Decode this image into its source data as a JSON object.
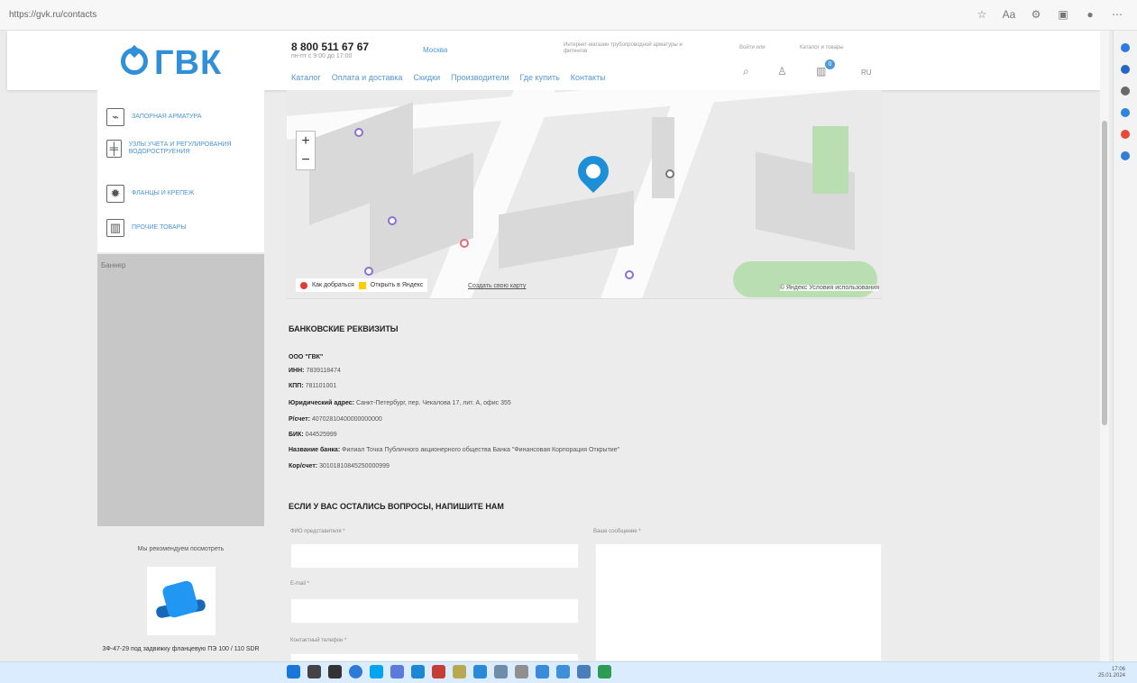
{
  "browser": {
    "address": "https://gvk.ru/contacts"
  },
  "header": {
    "logo": "ГВК",
    "phone": "8 800 511 67 67",
    "hours": "пн-пт с 9:00 до 17:00",
    "city": "Москва",
    "note": "Интернет-магазин трубопроводной арматуры и фитингов",
    "menu": [
      "Каталог",
      "Оплата и доставка",
      "Скидки",
      "Производители",
      "Где купить",
      "Контакты"
    ],
    "labels": {
      "left": "Войти или",
      "right": "Каталог и товары"
    },
    "cart_count": "0",
    "extra": "RU"
  },
  "sidebar": {
    "items": [
      {
        "label": "ЗАПОРНАЯ АРМАТУРА",
        "icon": "valve-icon"
      },
      {
        "label": "УЗЛЫ УЧЕТА И РЕГУЛИРОВАНИЯ ВОДОРОСТРУЕНИЯ",
        "icon": "pipe-icon"
      },
      {
        "label": "ФЛАНЦЫ И КРЕПЕЖ",
        "icon": "gear-icon"
      },
      {
        "label": "ПРОЧИЕ ТОВАРЫ",
        "icon": "box-icon"
      }
    ],
    "banner": "Баннер",
    "popular_title": "Мы рекомендуем посмотреть",
    "product": "ЗФ-47-29 под задвижку фланцевую ПЭ 100 / 110 SDR"
  },
  "map": {
    "zoom_in": "+",
    "zoom_out": "−",
    "route": "Как добраться",
    "open": "Открыть в Яндекс",
    "create": "Создать свою карту",
    "copyright": "© Яндекс Условия использования"
  },
  "bank": {
    "title": "Банковские реквизиты",
    "lines": [
      {
        "label": "ООО \"ГВК\"",
        "value": ""
      },
      {
        "label": "ИНН:",
        "value": "7839118474"
      },
      {
        "label": "КПП:",
        "value": "781101001"
      },
      {
        "label": "Юридический адрес:",
        "value": "Санкт-Петербург, пер. Чекалова 17, лит. А, офис 355"
      },
      {
        "label": "Р/счет:",
        "value": "40702810400000000000"
      },
      {
        "label": "БИК:",
        "value": "044525999"
      },
      {
        "label": "Название банка:",
        "value": "Филиал Точка Публичного акционерного общества Банка \"Финансовая Корпорация Открытие\""
      },
      {
        "label": "Кор/счет:",
        "value": "30101810845250000999"
      }
    ]
  },
  "form": {
    "title": "ЕСЛИ У ВАС ОСТАЛИСЬ ВОПРОСЫ, НАПИШИТЕ НАМ",
    "name": "ФИО представителя *",
    "email": "E-mail *",
    "phone": "Контактный телефон *",
    "message": "Ваше сообщение *"
  },
  "taskbar": {
    "time": "17:06",
    "date": "25.01.2024"
  }
}
